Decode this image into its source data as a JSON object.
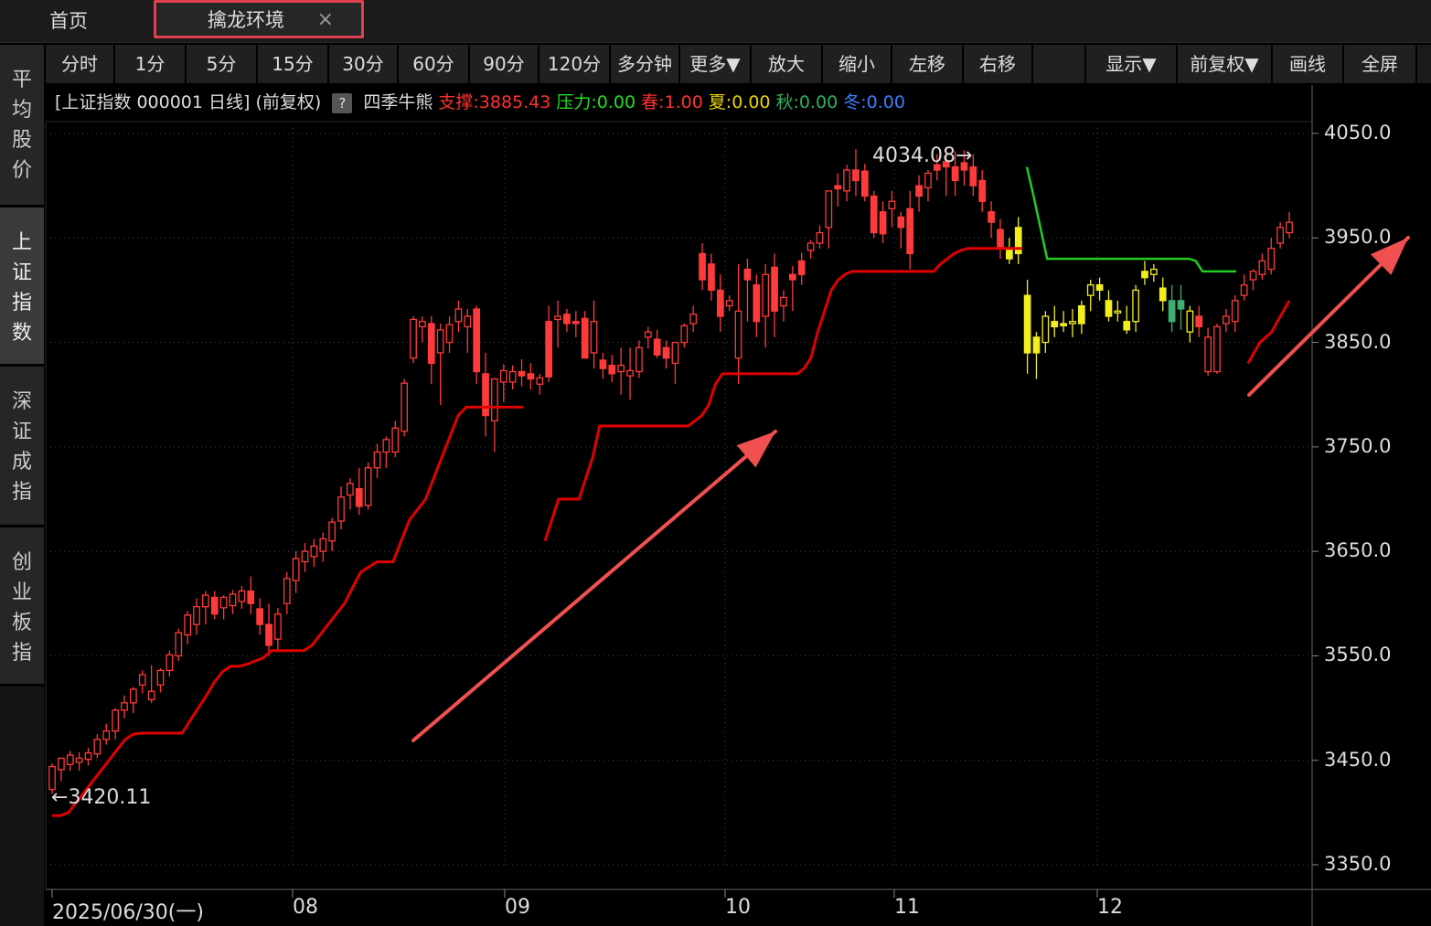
{
  "tabs": {
    "home": "首页",
    "active": "擒龙环境",
    "close": "×"
  },
  "toolbar": [
    "分时",
    "1分",
    "5分",
    "15分",
    "30分",
    "60分",
    "90分",
    "120分",
    "多分钟",
    "更多▼",
    "放大",
    "缩小",
    "左移",
    "右移",
    "",
    "显示▼",
    "前复权▼",
    "画线",
    "全屏"
  ],
  "sidebar": [
    "平均股价",
    "上证指数",
    "深证成指",
    "创业板指"
  ],
  "info": {
    "title": "[上证指数 000001 日线]",
    "adjust": "(前复权)",
    "help": "?",
    "indicator": "四季牛熊",
    "support_label": "支撑:",
    "support_value": "3885.43",
    "pressure_label": "压力:",
    "pressure_value": "0.00",
    "spring_label": "春:",
    "spring_value": "1.00",
    "summer_label": "夏:",
    "summer_value": "0.00",
    "autumn_label": "秋:",
    "autumn_value": "0.00",
    "winter_label": "冬:",
    "winter_value": "0.00"
  },
  "colors": {
    "up": "#ff3a3a",
    "support_line": "#e00000",
    "pressure_line": "#22cc22",
    "yellow": "#f2ee1e",
    "green_candle": "#3fae70",
    "arrow": "#f05050",
    "grid": "#444444",
    "info_support": "#ff3030",
    "info_pressure": "#22dd22",
    "info_spring": "#ff3030",
    "info_summer": "#e8d200",
    "info_autumn": "#2fb060",
    "info_winter": "#3a7fff"
  },
  "chart_data": {
    "type": "candlestick",
    "symbol": "上证指数 000001",
    "period": "日线",
    "yticks": [
      "4050.0",
      "3950.0",
      "3850.0",
      "3750.0",
      "3650.0",
      "3550.0",
      "3450.0",
      "3350.0"
    ],
    "ylim": [
      3336,
      4063
    ],
    "xticks": [
      "2025/06/30(一)",
      "08",
      "09",
      "10",
      "11",
      "12"
    ],
    "high_annotation": "4034.08",
    "low_annotation": "3420.11",
    "candles_ohlc": [
      [
        3422,
        3447,
        3418,
        3444
      ],
      [
        3441,
        3452,
        3430,
        3452
      ],
      [
        3446,
        3459,
        3440,
        3455
      ],
      [
        3448,
        3458,
        3440,
        3452
      ],
      [
        3451,
        3462,
        3445,
        3457
      ],
      [
        3456,
        3475,
        3452,
        3470
      ],
      [
        3470,
        3485,
        3465,
        3478
      ],
      [
        3478,
        3500,
        3470,
        3498
      ],
      [
        3498,
        3512,
        3490,
        3505
      ],
      [
        3505,
        3520,
        3495,
        3518
      ],
      [
        3522,
        3536,
        3514,
        3532
      ],
      [
        3508,
        3541,
        3505,
        3516
      ],
      [
        3522,
        3538,
        3515,
        3536
      ],
      [
        3536,
        3555,
        3530,
        3551
      ],
      [
        3550,
        3576,
        3545,
        3572
      ],
      [
        3570,
        3593,
        3561,
        3589
      ],
      [
        3580,
        3605,
        3570,
        3597
      ],
      [
        3597,
        3612,
        3580,
        3608
      ],
      [
        3606,
        3612,
        3585,
        3590
      ],
      [
        3596,
        3608,
        3585,
        3606
      ],
      [
        3598,
        3613,
        3590,
        3609
      ],
      [
        3602,
        3617,
        3595,
        3612
      ],
      [
        3612,
        3626,
        3590,
        3600
      ],
      [
        3595,
        3605,
        3570,
        3580
      ],
      [
        3580,
        3600,
        3550,
        3560
      ],
      [
        3566,
        3596,
        3555,
        3590
      ],
      [
        3600,
        3630,
        3590,
        3624
      ],
      [
        3622,
        3650,
        3610,
        3643
      ],
      [
        3640,
        3658,
        3630,
        3650
      ],
      [
        3645,
        3662,
        3635,
        3655
      ],
      [
        3650,
        3668,
        3640,
        3662
      ],
      [
        3660,
        3682,
        3650,
        3678
      ],
      [
        3679,
        3712,
        3671,
        3702
      ],
      [
        3704,
        3720,
        3690,
        3715
      ],
      [
        3710,
        3730,
        3685,
        3693
      ],
      [
        3694,
        3735,
        3690,
        3730
      ],
      [
        3730,
        3753,
        3720,
        3745
      ],
      [
        3745,
        3760,
        3730,
        3757
      ],
      [
        3745,
        3775,
        3740,
        3768
      ],
      [
        3765,
        3815,
        3760,
        3811
      ],
      [
        3835,
        3875,
        3830,
        3872
      ],
      [
        3865,
        3875,
        3850,
        3870
      ],
      [
        3868,
        3875,
        3810,
        3830
      ],
      [
        3840,
        3868,
        3790,
        3862
      ],
      [
        3850,
        3875,
        3840,
        3867
      ],
      [
        3870,
        3890,
        3860,
        3882
      ],
      [
        3865,
        3882,
        3840,
        3875
      ],
      [
        3882,
        3885,
        3810,
        3822
      ],
      [
        3820,
        3840,
        3760,
        3780
      ],
      [
        3775,
        3816,
        3745,
        3815
      ],
      [
        3812,
        3829,
        3793,
        3823
      ],
      [
        3812,
        3828,
        3805,
        3822
      ],
      [
        3822,
        3834,
        3808,
        3818
      ],
      [
        3820,
        3830,
        3805,
        3815
      ],
      [
        3810,
        3820,
        3800,
        3816
      ],
      [
        3870,
        3885,
        3812,
        3817
      ],
      [
        3872,
        3890,
        3845,
        3875
      ],
      [
        3877,
        3882,
        3860,
        3868
      ],
      [
        3870,
        3880,
        3855,
        3868
      ],
      [
        3873,
        3880,
        3835,
        3835
      ],
      [
        3840,
        3890,
        3825,
        3870
      ],
      [
        3833,
        3840,
        3815,
        3825
      ],
      [
        3828,
        3838,
        3812,
        3820
      ],
      [
        3822,
        3845,
        3800,
        3828
      ],
      [
        3818,
        3845,
        3795,
        3823
      ],
      [
        3822,
        3852,
        3816,
        3845
      ],
      [
        3855,
        3865,
        3844,
        3860
      ],
      [
        3853,
        3862,
        3835,
        3838
      ],
      [
        3845,
        3852,
        3825,
        3835
      ],
      [
        3830,
        3840,
        3810,
        3850
      ],
      [
        3850,
        3868,
        3845,
        3866
      ],
      [
        3868,
        3885,
        3860,
        3877
      ],
      [
        3935,
        3945,
        3900,
        3910
      ],
      [
        3925,
        3935,
        3890,
        3900
      ],
      [
        3900,
        3915,
        3860,
        3875
      ],
      [
        3885,
        3895,
        3880,
        3890
      ],
      [
        3835,
        3925,
        3810,
        3880
      ],
      [
        3920,
        3930,
        3870,
        3910
      ],
      [
        3905,
        3915,
        3855,
        3870
      ],
      [
        3875,
        3925,
        3845,
        3915
      ],
      [
        3922,
        3935,
        3855,
        3880
      ],
      [
        3885,
        3900,
        3870,
        3893
      ],
      [
        3915,
        3923,
        3880,
        3910
      ],
      [
        3928,
        3936,
        3905,
        3915
      ],
      [
        3938,
        3948,
        3930,
        3945
      ],
      [
        3945,
        3962,
        3940,
        3955
      ],
      [
        3960,
        3995,
        3940,
        3995
      ],
      [
        4000,
        4012,
        3980,
        3997
      ],
      [
        3995,
        4020,
        3985,
        4015
      ],
      [
        4015,
        4035,
        3990,
        4005
      ],
      [
        4014,
        4021,
        3985,
        3990
      ],
      [
        3990,
        3995,
        3950,
        3955
      ],
      [
        3975,
        3985,
        3945,
        3954
      ],
      [
        3978,
        3995,
        3960,
        3985
      ],
      [
        3970,
        3975,
        3940,
        3960
      ],
      [
        3978,
        3995,
        3920,
        3935
      ],
      [
        4000,
        4010,
        3975,
        3990
      ],
      [
        3998,
        4015,
        3985,
        4012
      ],
      [
        4020,
        4030,
        4005,
        4015
      ],
      [
        4023,
        4035,
        3990,
        4018
      ],
      [
        4018,
        4033,
        3990,
        4005
      ],
      [
        4022,
        4034,
        4000,
        4015
      ],
      [
        4018,
        4030,
        3990,
        4000
      ],
      [
        4005,
        4015,
        3975,
        3985
      ],
      [
        3975,
        3985,
        3950,
        3965
      ],
      [
        3958,
        3968,
        3930,
        3940
      ],
      [
        3940,
        3950,
        3925,
        3930
      ],
      [
        3960,
        3970,
        3925,
        3935
      ],
      [
        3895,
        3910,
        3820,
        3840
      ],
      [
        3855,
        3860,
        3815,
        3840
      ],
      [
        3850,
        3880,
        3840,
        3875
      ],
      [
        3870,
        3885,
        3855,
        3865
      ],
      [
        3868,
        3880,
        3860,
        3866
      ],
      [
        3868,
        3882,
        3855,
        3870
      ],
      [
        3885,
        3890,
        3858,
        3868
      ],
      [
        3895,
        3910,
        3880,
        3905
      ],
      [
        3905,
        3912,
        3890,
        3900
      ],
      [
        3890,
        3900,
        3870,
        3875
      ],
      [
        3880,
        3890,
        3870,
        3880
      ],
      [
        3870,
        3885,
        3858,
        3862
      ],
      [
        3870,
        3905,
        3860,
        3900
      ],
      [
        3918,
        3928,
        3905,
        3912
      ],
      [
        3915,
        3925,
        3908,
        3920
      ],
      [
        3902,
        3912,
        3880,
        3890
      ],
      [
        3890,
        3905,
        3860,
        3870
      ],
      [
        3890,
        3905,
        3862,
        3882
      ],
      [
        3860,
        3885,
        3850,
        3880
      ],
      [
        3875,
        3885,
        3855,
        3865
      ],
      [
        3822,
        3864,
        3818,
        3855
      ],
      [
        3822,
        3868,
        3820,
        3865
      ],
      [
        3868,
        3882,
        3860,
        3875
      ],
      [
        3870,
        3895,
        3860,
        3890
      ],
      [
        3895,
        3915,
        3890,
        3905
      ],
      [
        3910,
        3920,
        3900,
        3918
      ],
      [
        3915,
        3935,
        3910,
        3928
      ],
      [
        3920,
        3950,
        3915,
        3940
      ],
      [
        3945,
        3965,
        3940,
        3960
      ],
      [
        3955,
        3975,
        3950,
        3965
      ]
    ],
    "candle_styles": "red = 上涨/下跌 (hollow/solid); yellow and green candles in the later segment",
    "support_line": [
      3397,
      3397,
      3400,
      3410,
      3420,
      3430,
      3440,
      3450,
      3460,
      3470,
      3475,
      3476,
      3476,
      3476,
      3476,
      3476,
      3476,
      3488,
      3500,
      3512,
      3525,
      3535,
      3540,
      3540,
      3542,
      3545,
      3548,
      3555,
      3555,
      3555,
      3555,
      3555,
      3560,
      3570,
      3580,
      3590,
      3600,
      3615,
      3630,
      3635,
      3640,
      3640,
      3640,
      3660,
      3680,
      3690,
      3700,
      3720,
      3740,
      3760,
      3780,
      3788,
      3788,
      3788,
      3788,
      3788,
      3788,
      3788,
      3788
    ],
    "support_line_2": [
      3660,
      3680,
      3700,
      3700,
      3700,
      3700,
      3720,
      3740,
      3770,
      3770,
      3770,
      3770,
      3770,
      3770,
      3770,
      3770,
      3770,
      3770,
      3770,
      3770,
      3770,
      3770,
      3775,
      3780,
      3790,
      3810,
      3820,
      3820,
      3820,
      3820,
      3820,
      3820,
      3820,
      3820,
      3820,
      3820,
      3820,
      3820,
      3825,
      3835,
      3860,
      3880,
      3900,
      3910,
      3915,
      3918,
      3918,
      3918,
      3918,
      3918,
      3918,
      3918,
      3918,
      3918,
      3918,
      3918,
      3918,
      3918,
      3925,
      3930,
      3935,
      3938,
      3940,
      3940,
      3940,
      3940,
      3940,
      3940,
      3940,
      3940,
      3940
    ],
    "pressure_line": [
      4018,
      3990,
      3960,
      3930,
      3930,
      3930,
      3930,
      3930,
      3930,
      3930,
      3930,
      3930,
      3930,
      3930,
      3930,
      3930,
      3930,
      3930,
      3930,
      3930,
      3930,
      3930,
      3930,
      3930,
      3930,
      3928,
      3918,
      3918,
      3918,
      3918,
      3918,
      3918
    ],
    "support_line_3": [
      3830,
      3840,
      3850,
      3855,
      3860,
      3870,
      3880,
      3890
    ]
  }
}
